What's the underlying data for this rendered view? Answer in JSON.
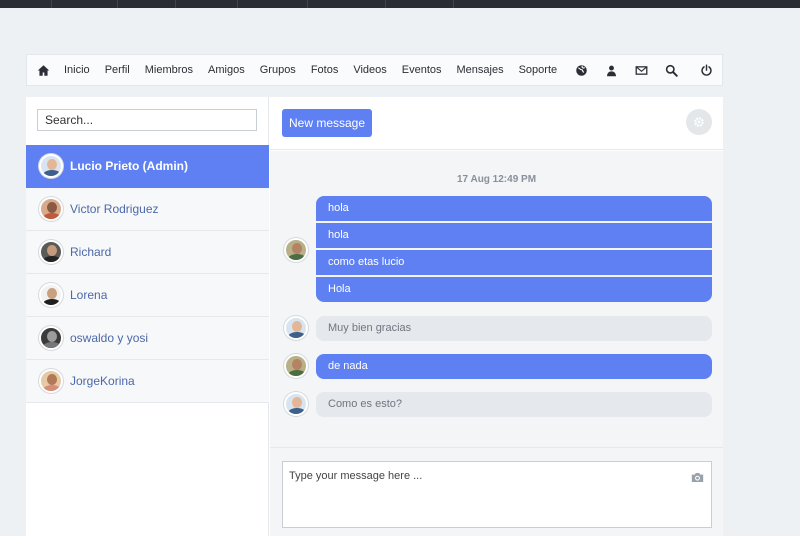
{
  "navbar": {
    "home_icon": "home-icon",
    "items": [
      {
        "label": "Inicio"
      },
      {
        "label": "Perfil"
      },
      {
        "label": "Miembros"
      },
      {
        "label": "Amigos"
      },
      {
        "label": "Grupos"
      },
      {
        "label": "Fotos"
      },
      {
        "label": "Videos"
      },
      {
        "label": "Eventos"
      },
      {
        "label": "Mensajes"
      },
      {
        "label": "Soporte"
      }
    ],
    "icons": [
      "globe-icon",
      "user-icon",
      "mail-icon",
      "search-icon",
      "power-icon"
    ]
  },
  "sidebar": {
    "search": {
      "placeholder": "Search...",
      "value": ""
    },
    "contacts": [
      {
        "name": "Lucio Prieto (Admin)",
        "active": true
      },
      {
        "name": "Victor Rodriguez",
        "active": false
      },
      {
        "name": "Richard",
        "active": false
      },
      {
        "name": "Lorena",
        "active": false
      },
      {
        "name": "oswaldo y yosi",
        "active": false
      },
      {
        "name": "JorgeKorina",
        "active": false
      }
    ]
  },
  "chat": {
    "new_message_label": "New message",
    "settings_icon": "gear-icon",
    "timestamp": "17 Aug 12:49 PM",
    "groups": [
      {
        "direction": "out",
        "messages": [
          "hola",
          "hola",
          "como etas lucio",
          "Hola"
        ]
      },
      {
        "direction": "in",
        "messages": [
          "Muy bien gracias"
        ]
      },
      {
        "direction": "out",
        "messages": [
          "de nada"
        ]
      },
      {
        "direction": "in",
        "messages": [
          "Como es esto?"
        ]
      }
    ],
    "composer": {
      "placeholder": "Type your message here ...",
      "value": "",
      "camera_icon": "camera-icon"
    }
  },
  "colors": {
    "accent": "#5f80f3",
    "incoming_bubble": "#e5e8ec",
    "topbar": "#2a2d33"
  }
}
